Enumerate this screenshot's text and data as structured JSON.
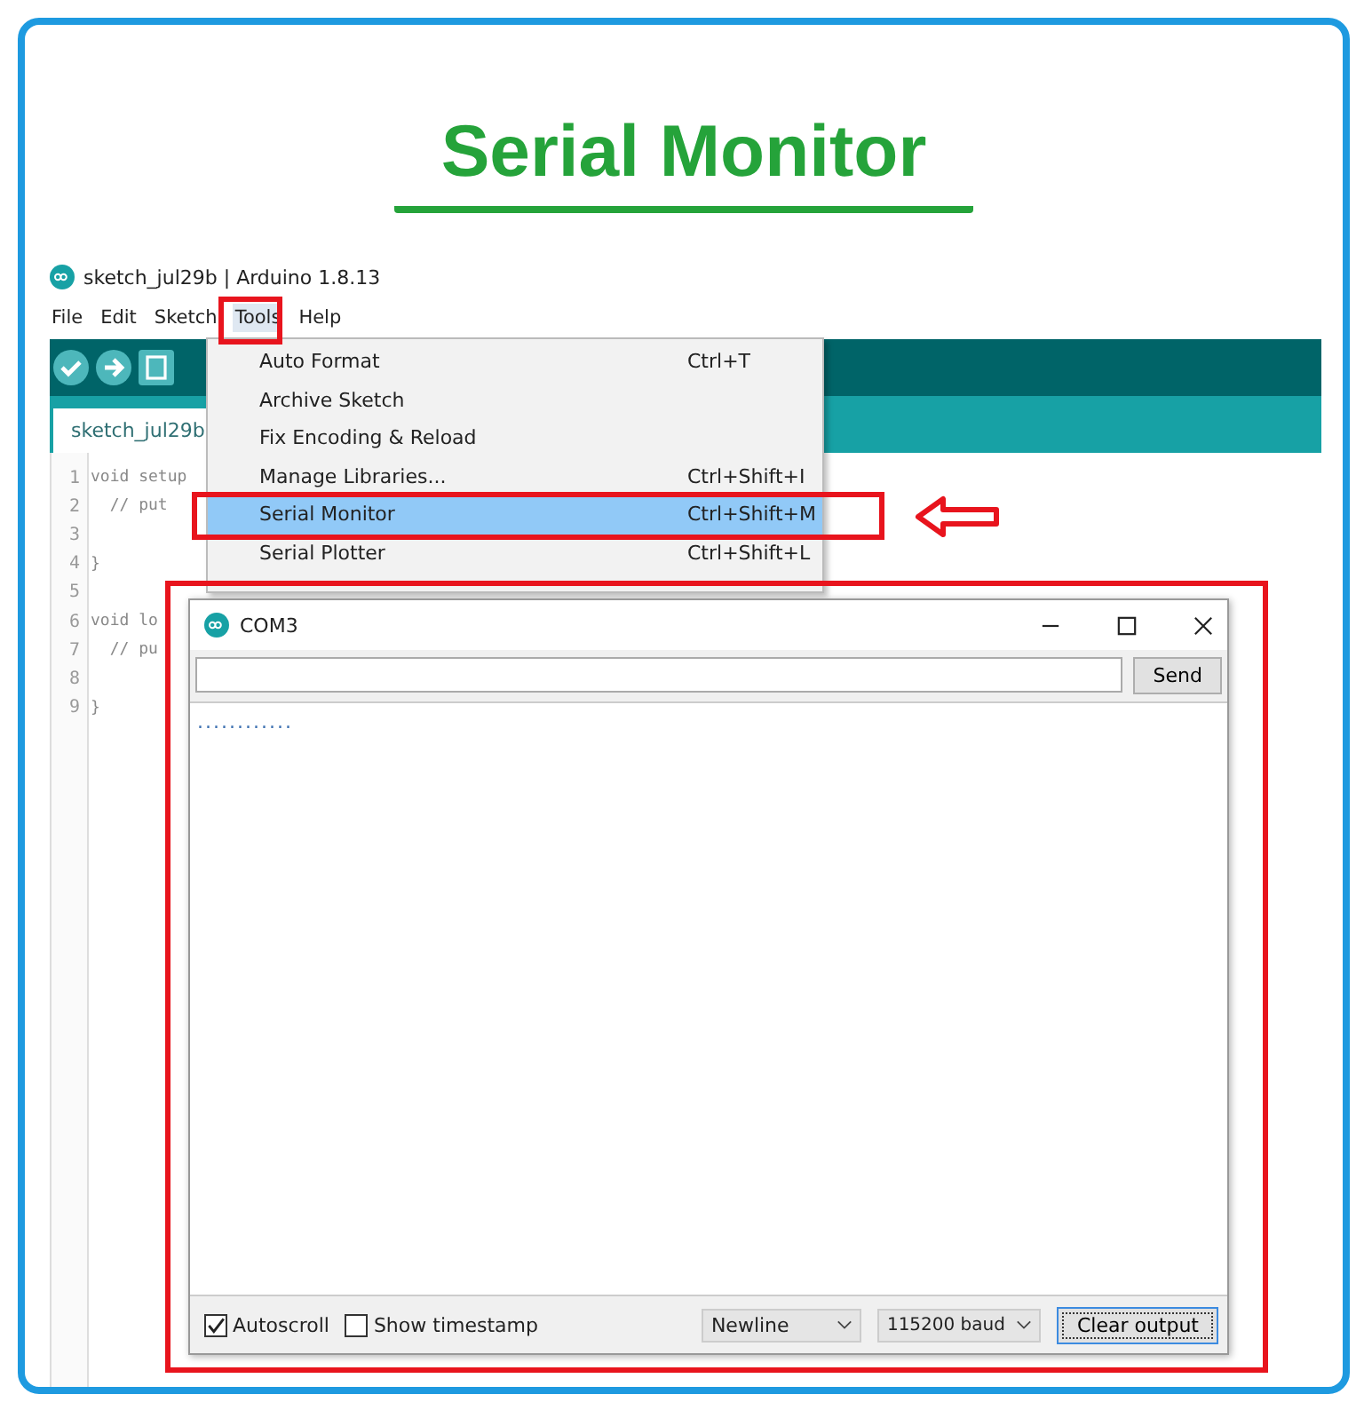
{
  "heading": "Serial Monitor",
  "ide": {
    "title": "sketch_jul29b | Arduino 1.8.13",
    "menubar": [
      {
        "label": "File",
        "selected": false
      },
      {
        "label": "Edit",
        "selected": false
      },
      {
        "label": "Sketch",
        "selected": false
      },
      {
        "label": "Tools",
        "selected": true
      },
      {
        "label": "Help",
        "selected": false
      }
    ],
    "tab": "sketch_jul29b",
    "code": [
      {
        "num": "1",
        "text": "void setup"
      },
      {
        "num": "2",
        "text": "  // put"
      },
      {
        "num": "3"
      },
      {
        "num": "4",
        "text": "}"
      },
      {
        "num": "5"
      },
      {
        "num": "6",
        "text": "void lo"
      },
      {
        "num": "7",
        "text": "  // pu"
      },
      {
        "num": "8"
      },
      {
        "num": "9",
        "text": "}"
      }
    ]
  },
  "tools_menu": [
    {
      "label": "Auto Format",
      "shortcut": "Ctrl+T",
      "selected": false
    },
    {
      "label": "Archive Sketch",
      "selected": false
    },
    {
      "label": "Fix Encoding & Reload",
      "selected": false
    },
    {
      "label": "Manage Libraries...",
      "shortcut": "Ctrl+Shift+I",
      "selected": false
    },
    {
      "label": "Serial Monitor",
      "shortcut": "Ctrl+Shift+M",
      "selected": true
    },
    {
      "label": "Serial Plotter",
      "shortcut": "Ctrl+Shift+L",
      "selected": false
    }
  ],
  "serial_monitor": {
    "title": "COM3",
    "send": "Send",
    "output": "............",
    "autoscroll": {
      "label": "Autoscroll",
      "checked": true
    },
    "timestamp": {
      "label": "Show timestamp",
      "checked": false
    },
    "line_ending": "Newline",
    "baud": "115200 baud",
    "clear": "Clear output"
  }
}
